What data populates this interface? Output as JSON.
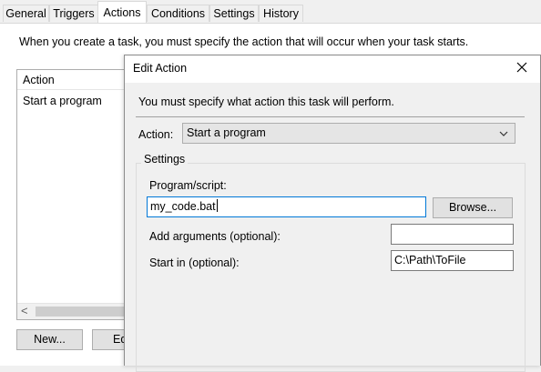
{
  "tabs": [
    "General",
    "Triggers",
    "Actions",
    "Conditions",
    "Settings",
    "History"
  ],
  "intro_text": "When you create a task, you must specify the action that will occur when your task starts.",
  "action_list": {
    "header": "Action",
    "rows": [
      "Start a program"
    ],
    "scroll_left_arrow": "<"
  },
  "buttons": {
    "new": "New...",
    "edit": "Ed"
  },
  "dialog": {
    "title": "Edit Action",
    "message": "You must specify what action this task will perform.",
    "action_label": "Action:",
    "action_value": "Start a program",
    "settings_label": "Settings",
    "program_label": "Program/script:",
    "program_value": "my_code.bat",
    "browse_label": "Browse...",
    "args_label": "Add arguments (optional):",
    "args_value": "",
    "startin_label": "Start in (optional):",
    "startin_value": "C:\\Path\\ToFile"
  },
  "icons": {
    "close": "close-icon",
    "dropdown": "chevron-down-icon"
  },
  "colors": {
    "focus_border": "#0078d7",
    "window_bg": "#f0f0f0"
  }
}
